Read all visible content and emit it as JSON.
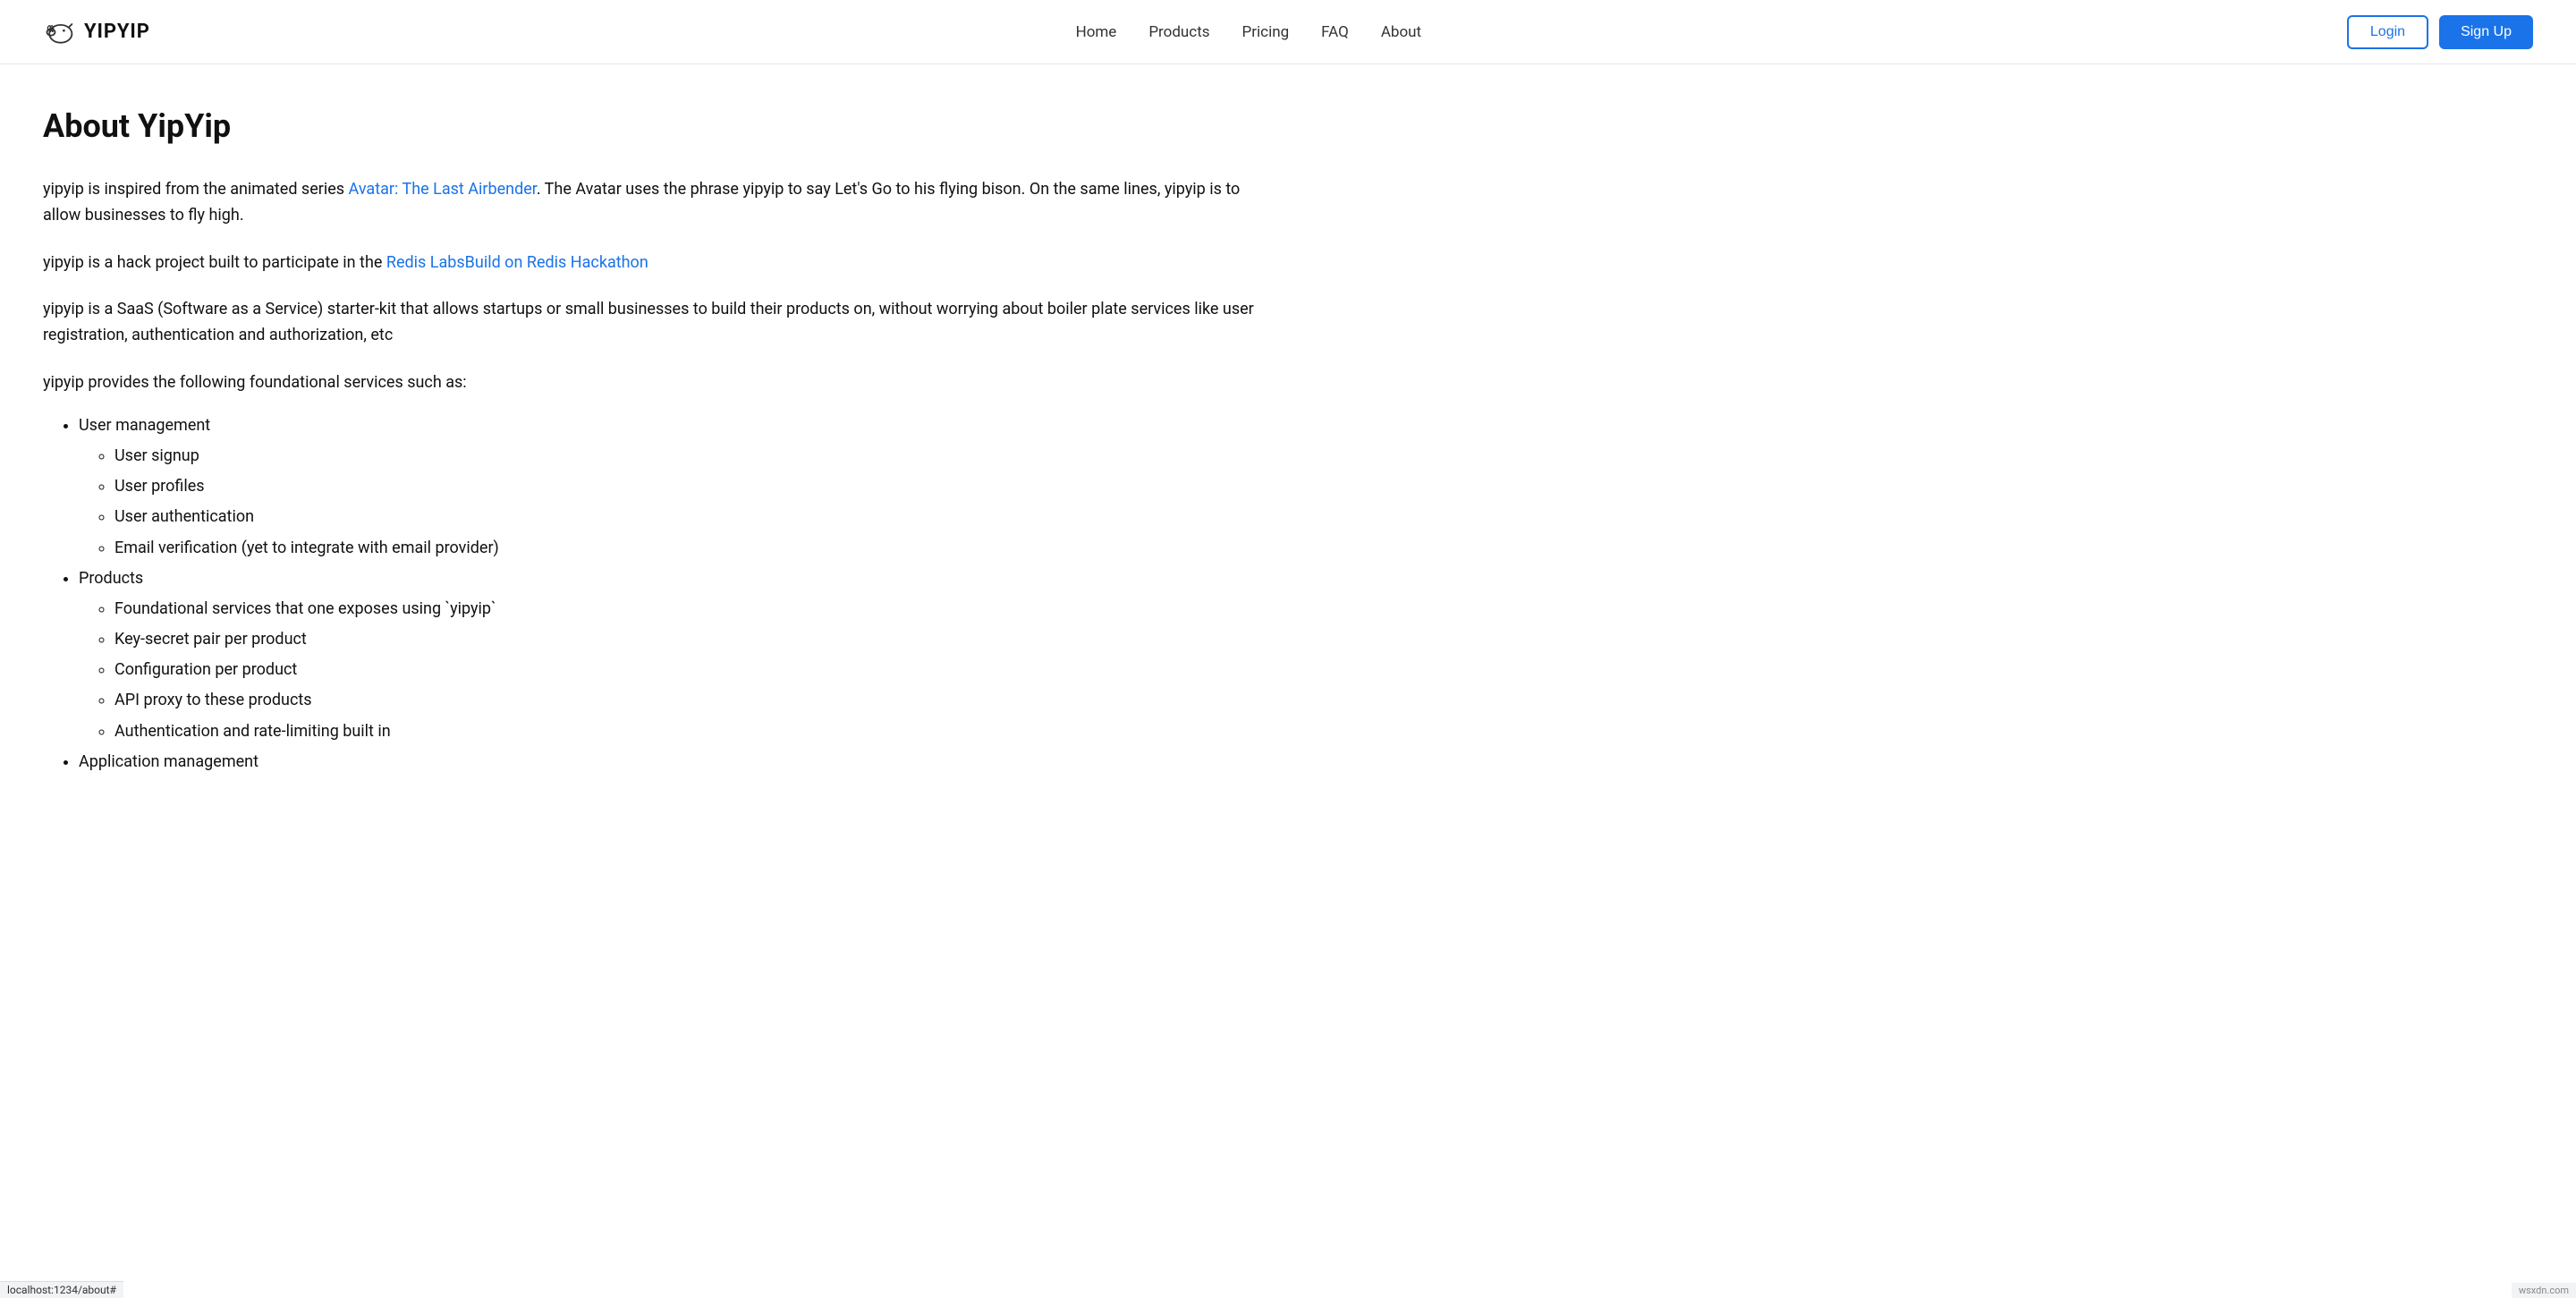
{
  "header": {
    "logo_text": "YIPYIP",
    "nav_items": [
      {
        "label": "Home",
        "href": "#"
      },
      {
        "label": "Products",
        "href": "#"
      },
      {
        "label": "Pricing",
        "href": "#"
      },
      {
        "label": "FAQ",
        "href": "#"
      },
      {
        "label": "About",
        "href": "#"
      }
    ],
    "login_label": "Login",
    "signup_label": "Sign Up"
  },
  "main": {
    "page_title": "About YipYip",
    "para1_before_link": "yipyip is inspired from the animated series ",
    "para1_link_text": "Avatar: The Last Airbender",
    "para1_link_href": "#",
    "para1_after_link": ". The Avatar uses the phrase yipyip to say Let's Go to his flying bison. On the same lines, yipyip is to allow businesses to fly high.",
    "para2_before_link": "yipyip is a hack project built to participate in the ",
    "para2_link_text": "Redis LabsBuild on Redis Hackathon",
    "para2_link_href": "#",
    "para2_after_link": "",
    "para3": "yipyip is a SaaS (Software as a Service) starter-kit that allows startups or small businesses to build their products on, without worrying about boiler plate services like user registration, authentication and authorization, etc",
    "services_intro": "yipyip provides the following foundational services such as:",
    "top_list": [
      {
        "label": "User management",
        "sub_items": [
          "User signup",
          "User profiles",
          "User authentication",
          "Email verification (yet to integrate with email provider)"
        ]
      },
      {
        "label": "Products",
        "sub_items": [
          "Foundational services that one exposes using `yipyip`",
          "Key-secret pair per product",
          "Configuration per product",
          "API proxy to these products",
          "Authentication and rate-limiting built in"
        ]
      },
      {
        "label": "Application management",
        "sub_items": []
      }
    ]
  },
  "statusbar": {
    "url": "localhost:1234/about#",
    "badge": "wsxdn.com"
  }
}
